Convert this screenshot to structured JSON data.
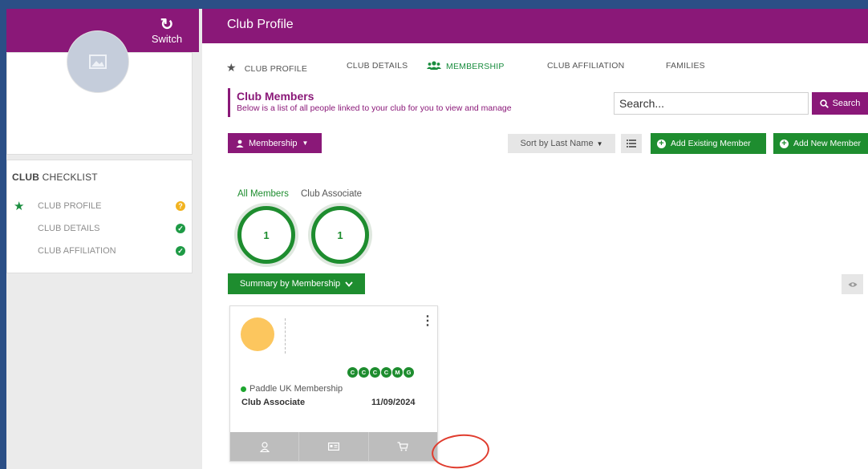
{
  "sidebar": {
    "switch_label": "Switch",
    "checklist": {
      "title_bold": "CLUB",
      "title_rest": " CHECKLIST",
      "items": [
        {
          "label": "CLUB PROFILE",
          "status": "warning"
        },
        {
          "label": "CLUB DETAILS",
          "status": "complete"
        },
        {
          "label": "CLUB AFFILIATION",
          "status": "complete"
        }
      ]
    }
  },
  "header": {
    "title": "Club Profile"
  },
  "tabs": [
    {
      "label": "CLUB PROFILE",
      "icon": "star-icon"
    },
    {
      "label": "CLUB DETAILS"
    },
    {
      "label": "MEMBERSHIP",
      "icon": "users-icon",
      "active": true
    },
    {
      "label": "CLUB AFFILIATION"
    },
    {
      "label": "FAMILIES"
    }
  ],
  "members": {
    "title": "Club Members",
    "subtitle": "Below is a list of all people linked to your club for you to view and manage"
  },
  "search": {
    "value": "Search...",
    "button_label": "Search"
  },
  "toolbar": {
    "membership_label": "Membership",
    "sort_label": "Sort by Last Name",
    "add_existing_label": "Add Existing Member",
    "add_new_label": "Add New Member"
  },
  "categories": [
    {
      "label": "All Members",
      "count": "1",
      "active": true
    },
    {
      "label": "Club Associate",
      "count": "1"
    }
  ],
  "summary_label": "Summary by Membership",
  "member_card": {
    "pills": [
      "C",
      "C",
      "C",
      "C",
      "M",
      "G"
    ],
    "membership": "Paddle UK Membership",
    "type": "Club Associate",
    "date": "11/09/2024"
  },
  "colors": {
    "brand": "#8a1878",
    "green": "#1e8d2f",
    "annotation": "#e03c2e"
  }
}
